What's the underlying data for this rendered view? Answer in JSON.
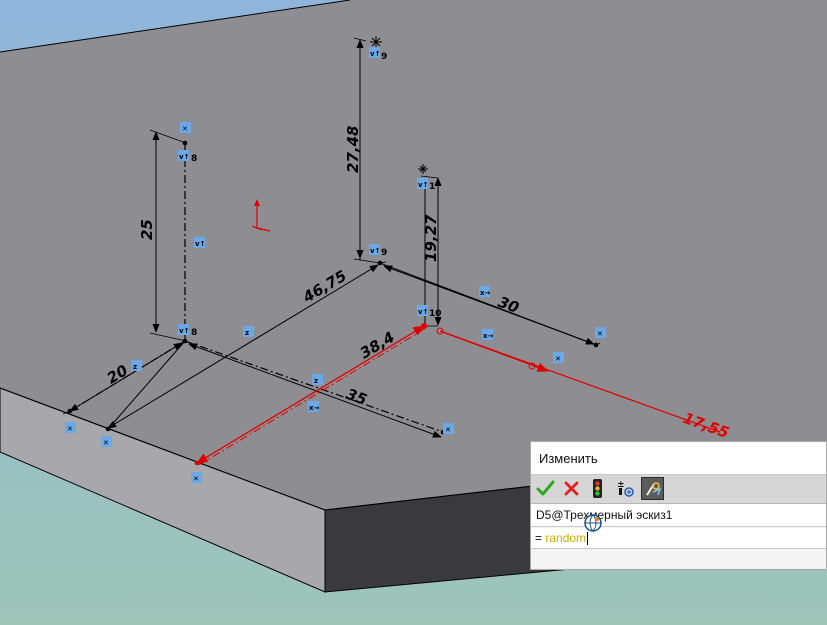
{
  "dimensions": {
    "d25": "25",
    "d27_48": "27,48",
    "d19_27": "19,27",
    "d46_75": "46,75",
    "d30": "30",
    "d20": "20",
    "d38_4": "38,4",
    "d35": "35",
    "d17_55": "17,55"
  },
  "relation_tags": {
    "t8a": "8",
    "t8b": "8",
    "t9a": "9",
    "t9b": "9",
    "t10": "10",
    "t1": "1"
  },
  "dialog": {
    "title": "Изменить",
    "dimension_name": "D5@Трехмерный эскиз1",
    "value_prefix": "=",
    "value": "random"
  },
  "colors": {
    "sky_top": "#8fb5dc",
    "sky_bottom": "#9ec5b8",
    "plate_top": "#8e8d92",
    "plate_front": "#a8a8ac",
    "plate_side": "#3a3a3e",
    "selected_red": "#e00000",
    "relation_blue": "#6aa8e8"
  },
  "icons": {
    "accept": "check-icon",
    "cancel": "x-icon",
    "rebuild": "traffic-light-icon",
    "reset_spin": "spin-increment-icon",
    "mark_driving": "dimension-mark-icon"
  }
}
